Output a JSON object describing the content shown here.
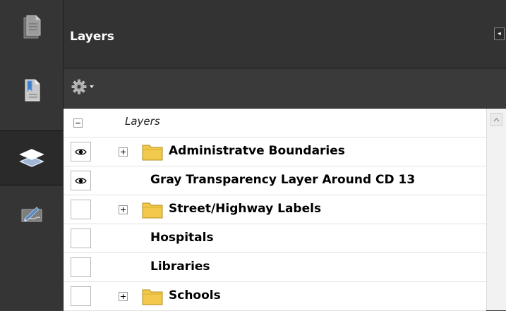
{
  "sidebar": {
    "buttons": [
      {
        "name": "pages-icon"
      },
      {
        "name": "bookmarks-icon"
      },
      {
        "name": "layers-icon",
        "active": true
      },
      {
        "name": "signatures-icon"
      }
    ]
  },
  "panel": {
    "title": "Layers",
    "collapse_glyph": "◂",
    "options_icon": "gear-icon"
  },
  "tree": {
    "root_label": "Layers",
    "rows": [
      {
        "label": "Administratve Boundaries",
        "visible": true,
        "expandable": true,
        "folder": true
      },
      {
        "label": "Gray Transparency Layer Around CD 13",
        "visible": true,
        "expandable": false,
        "folder": false
      },
      {
        "label": "Street/Highway Labels",
        "visible": false,
        "expandable": true,
        "folder": true
      },
      {
        "label": "Hospitals",
        "visible": false,
        "expandable": false,
        "folder": false
      },
      {
        "label": "Libraries",
        "visible": false,
        "expandable": false,
        "folder": false
      },
      {
        "label": "Schools",
        "visible": false,
        "expandable": true,
        "folder": true
      }
    ]
  },
  "colors": {
    "panel_header": "#333333",
    "sidebar": "#353535",
    "folder": "#f2c94c"
  }
}
